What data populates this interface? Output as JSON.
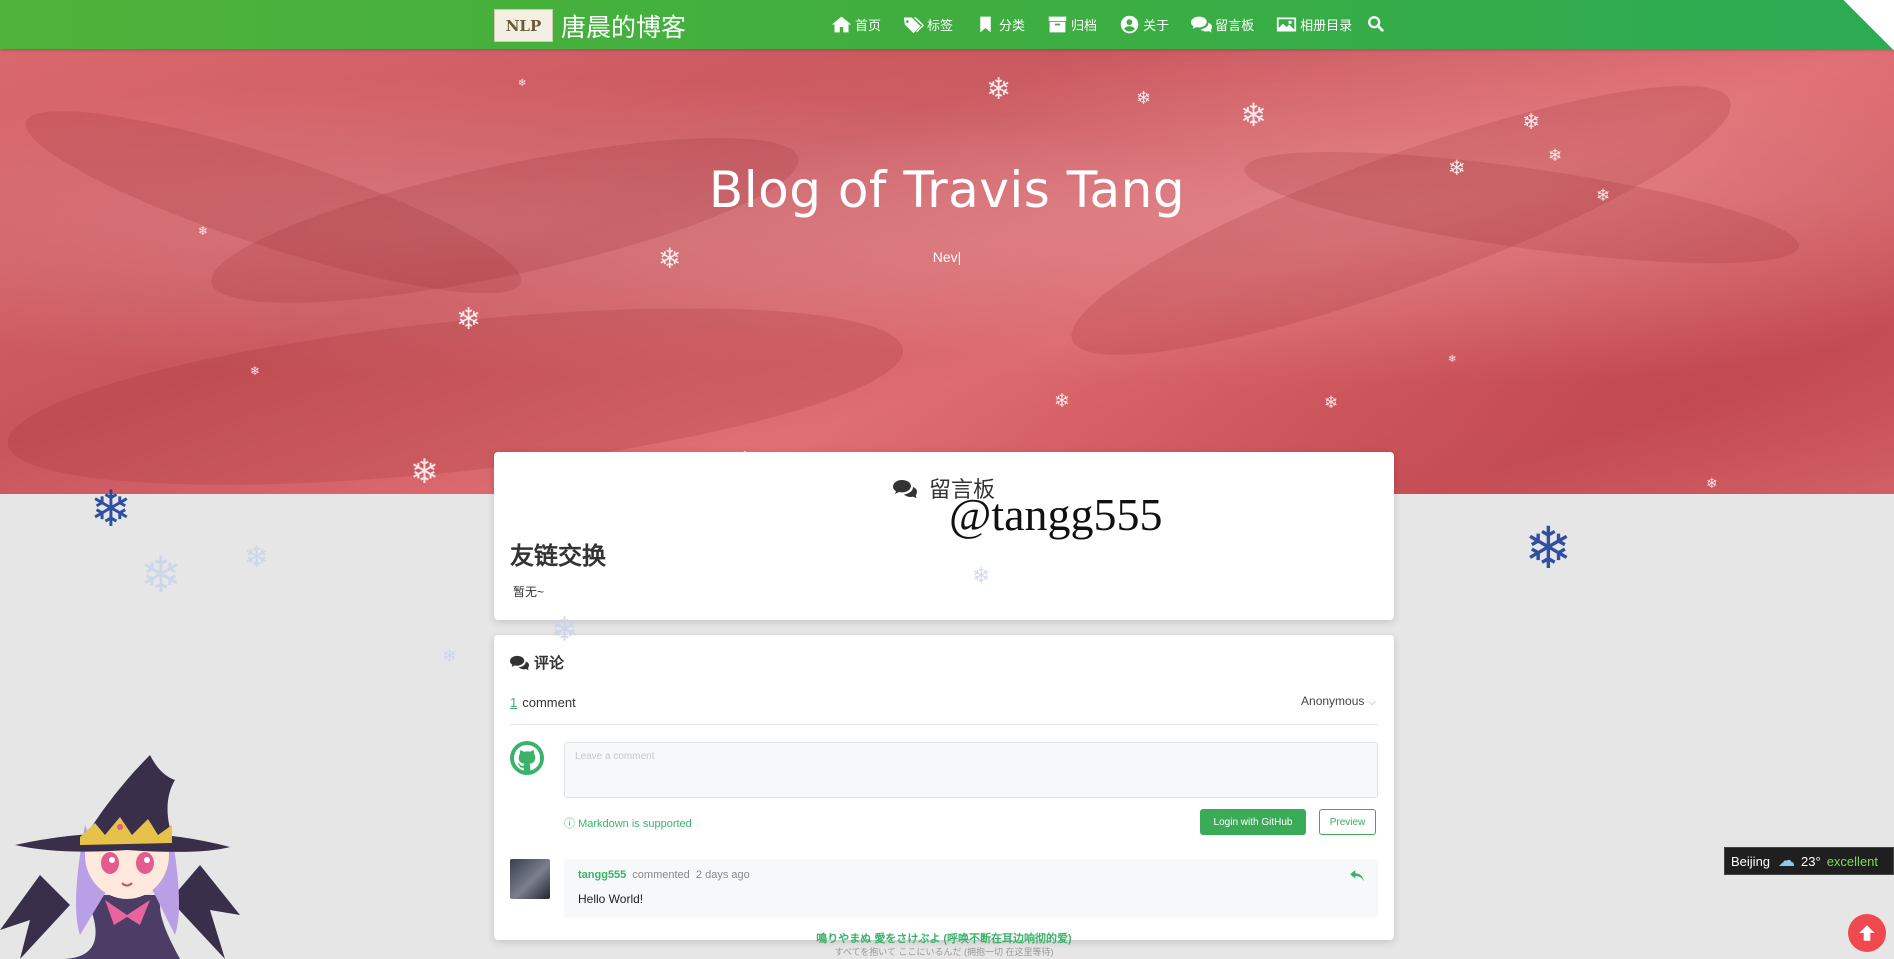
{
  "nav": {
    "brand_logo_text": "NLP",
    "brand_title": "唐晨的博客",
    "items": [
      {
        "label": "首页",
        "icon": "home-icon"
      },
      {
        "label": "标签",
        "icon": "tags-icon"
      },
      {
        "label": "分类",
        "icon": "bookmark-icon"
      },
      {
        "label": "归档",
        "icon": "archive-icon"
      },
      {
        "label": "关于",
        "icon": "user-circle-icon"
      },
      {
        "label": "留言板",
        "icon": "comments-icon"
      },
      {
        "label": "相册目录",
        "icon": "image-icon"
      }
    ],
    "search_icon": "search-icon"
  },
  "hero": {
    "title": "Blog of Travis Tang",
    "subtitle": "Nev|"
  },
  "guestbook": {
    "heading": "留言板",
    "watermark": "@tangg555",
    "section_title": "友链交换",
    "empty_text": "暂无~"
  },
  "comments": {
    "heading": "评论",
    "count": "1",
    "count_label": "comment",
    "identity": "Anonymous",
    "placeholder": "Leave a comment",
    "markdown_tip": "Markdown is supported",
    "login_button": "Login with GitHub",
    "preview_button": "Preview",
    "items": [
      {
        "user": "tangg555",
        "action": "commented",
        "time": "2 days ago",
        "body": "Hello World!"
      }
    ]
  },
  "footer": {
    "lyric_line1": "鳴りやまぬ 愛をさけぶよ (呼唤不断在耳边响彻的爱)",
    "lyric_line2": "すべてを抱いて ここにいるんだ (拥抱一切 在这里等待)"
  },
  "weather": {
    "city": "Beijing",
    "temperature": "23°",
    "quality": "excellent",
    "icon": "partly-cloudy-icon"
  },
  "colors": {
    "nav_green": "#3fae3f",
    "accent_green": "#3ab36a",
    "hero_red": "#d9686e",
    "top_button_red": "#f0484f"
  }
}
